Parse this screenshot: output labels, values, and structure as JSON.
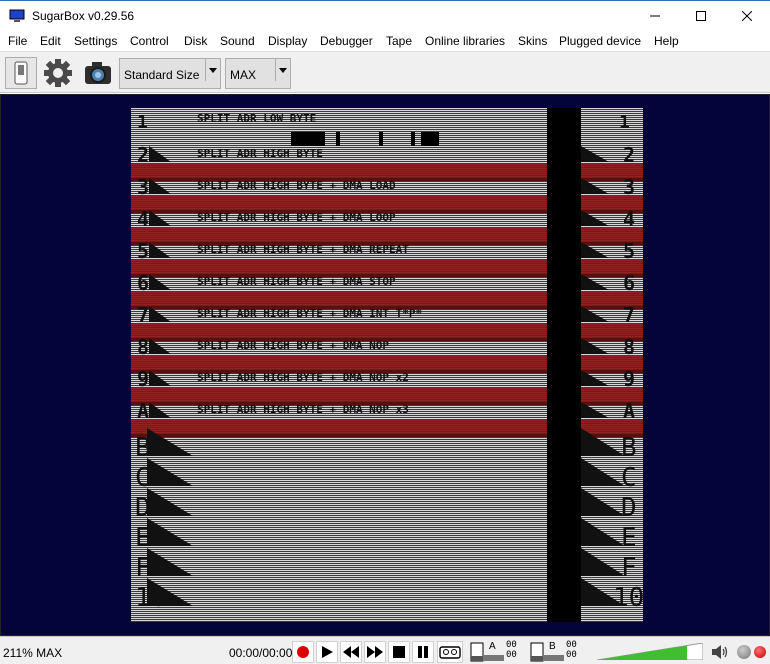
{
  "window": {
    "title": "SugarBox v0.29.56"
  },
  "menu": [
    "File",
    "Edit",
    "Settings",
    "Control",
    "Disk",
    "Sound",
    "Display",
    "Debugger",
    "Tape",
    "Online libraries",
    "Skins",
    "Plugged device",
    "Help"
  ],
  "toolbar": {
    "size_combo": "Standard Size",
    "speed_combo": "MAX",
    "icons": [
      "power-switch-icon",
      "gear-icon",
      "camera-icon"
    ]
  },
  "emulator": {
    "header_line1": "SPLIT ADR  LOW BYTE",
    "rows": [
      {
        "marker": "2",
        "text": "SPLIT ADR  HIGH BYTE"
      },
      {
        "marker": "3",
        "text": "SPLIT ADR  HIGH BYTE + DMA LOAD"
      },
      {
        "marker": "4",
        "text": "SPLIT ADR  HIGH BYTE + DMA LOOP"
      },
      {
        "marker": "5",
        "text": "SPLIT ADR  HIGH BYTE + DMA REPEAT"
      },
      {
        "marker": "6",
        "text": "SPLIT ADR  HIGH BYTE + DMA STOP"
      },
      {
        "marker": "7",
        "text": "SPLIT ADR  HIGH BYTE + DMA INT  T*P*"
      },
      {
        "marker": "8",
        "text": "SPLIT ADR  HIGH BYTE + DMA NOP"
      },
      {
        "marker": "9",
        "text": "SPLIT ADR  HIGH BYTE + DMA NOP x2"
      },
      {
        "marker": "A",
        "text": "SPLIT ADR  HIGH BYTE + DMA NOP x3"
      }
    ],
    "lower_markers": [
      "B",
      "C",
      "D",
      "E",
      "F",
      "10"
    ],
    "stripe_color": "#8b1212"
  },
  "status": {
    "zoom": "211% MAX",
    "time": "00:00/00:00",
    "drive_a_label": "A",
    "drive_b_label": "B",
    "drive_a_track": "00",
    "drive_b_track": "00",
    "volume_level": 0.85,
    "colors": {
      "record": "#e00000",
      "volume_green": "#3fbf2e"
    }
  }
}
